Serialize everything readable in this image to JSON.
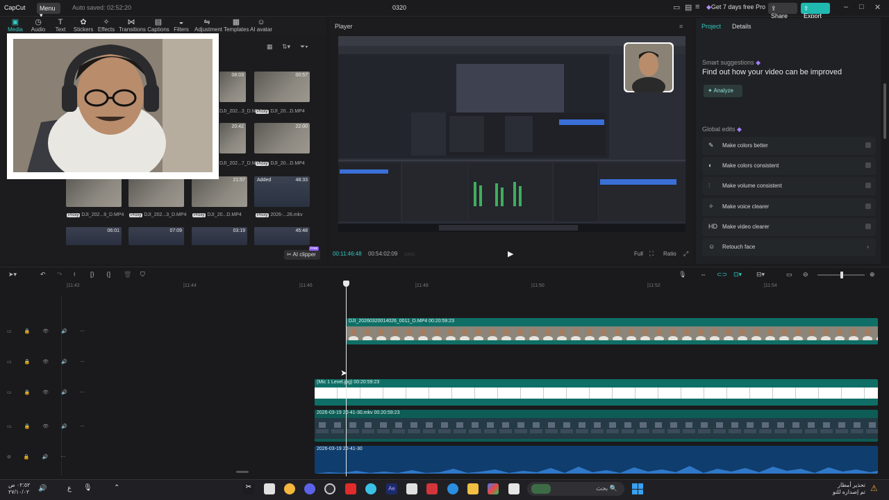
{
  "titlebar": {
    "logo": "CapCut",
    "menu_label": "Menu",
    "autosave": "Auto saved: 02:52:20",
    "project_name": "0320",
    "pro_label": "Get 7 days free Pro",
    "share_label": "Share",
    "export_label": "Export"
  },
  "toolbar": {
    "items": [
      {
        "label": "Media",
        "icon": "▣"
      },
      {
        "label": "Audio",
        "icon": "◷"
      },
      {
        "label": "Text",
        "icon": "T"
      },
      {
        "label": "Stickers",
        "icon": "✿"
      },
      {
        "label": "Effects",
        "icon": "✧"
      },
      {
        "label": "Transitions",
        "icon": "⋈"
      },
      {
        "label": "Captions",
        "icon": "▤"
      },
      {
        "label": "Filters",
        "icon": "◒"
      },
      {
        "label": "Adjustment",
        "icon": "⇋"
      },
      {
        "label": "Templates",
        "icon": "▦"
      },
      {
        "label": "AI avatar",
        "icon": "☺"
      }
    ]
  },
  "media": {
    "thumbs": [
      {
        "dur": "08:03",
        "label": "DJI_202...3_D.MP4"
      },
      {
        "dur": "00:57",
        "label": "DJI_20...D.MP4"
      },
      {
        "dur": "20:42",
        "label": "DJI_202...7_D.MP4"
      },
      {
        "dur": "22:00",
        "label": "DJI_20...D.MP4"
      },
      {
        "dur": "",
        "label": "DJI_202...9_D.MP4"
      },
      {
        "dur": "",
        "label": "DJI_202...3_D.MP4"
      },
      {
        "dur": "21:57",
        "label": "DJI_20...D.MP4"
      },
      {
        "dur": "48:33",
        "label": "2026-...26.mkv",
        "added": "Added"
      },
      {
        "dur": "06:01",
        "label": ""
      },
      {
        "dur": "07:09",
        "label": ""
      },
      {
        "dur": "03:19",
        "label": ""
      },
      {
        "dur": "45:48",
        "label": ""
      }
    ],
    "proxy": "Proxy",
    "ai_clipper": "AI clipper",
    "free_badge": "Free"
  },
  "player": {
    "title": "Player",
    "time_current": "00:11:46:48",
    "time_total": "00:54:02:09"
  },
  "right": {
    "tabs": [
      "Project",
      "Details"
    ],
    "smart_title": "Smart suggestions",
    "smart_sub": "Find out how your video can be improved",
    "analyze": "Analyze",
    "global_title": "Global edits",
    "items": [
      {
        "icon": "✎",
        "label": "Make colors better"
      },
      {
        "icon": "◐",
        "label": "Make colors consistent"
      },
      {
        "icon": "⫶",
        "label": "Make volume consistent"
      },
      {
        "icon": "✧",
        "label": "Make voice clearer"
      },
      {
        "icon": "HD",
        "label": "Make video clearer"
      },
      {
        "icon": "☺",
        "label": "Retouch face"
      }
    ]
  },
  "timeline": {
    "ruler": [
      "|11:42",
      "|11:44",
      "|11:46",
      "|11:48",
      "|11:50",
      "|11:52",
      "|11:54"
    ],
    "clips": [
      {
        "label": "DJI_20260320014026_0011_D.MP4   00:20:59:23"
      },
      {
        "label": "(Mic 1 Level.jpg)   00:20:59:23"
      },
      {
        "label": "2026-03-19 20-41-30.mkv   00:20:59:23"
      },
      {
        "label": "2026-03-19 20-41-30"
      }
    ]
  },
  "taskbar": {
    "clock_time": "٠٢:٥٢ ص",
    "clock_date": "٢٧/١٠/٠٢",
    "search_placeholder": "بحث",
    "notice_title": "تحذير أمطار",
    "notice_sub": "تم إصداره للتو"
  }
}
